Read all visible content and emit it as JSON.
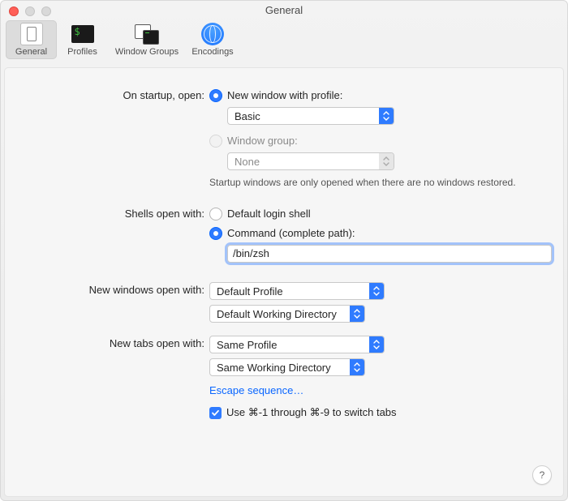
{
  "window_title": "General",
  "toolbar": {
    "items": [
      {
        "label": "General"
      },
      {
        "label": "Profiles"
      },
      {
        "label": "Window Groups"
      },
      {
        "label": "Encodings"
      }
    ]
  },
  "startup": {
    "section_label": "On startup, open:",
    "new_window_label": "New window with profile:",
    "profile_value": "Basic",
    "window_group_label": "Window group:",
    "window_group_value": "None",
    "hint": "Startup windows are only opened when there are no windows restored."
  },
  "shells": {
    "section_label": "Shells open with:",
    "default_label": "Default login shell",
    "command_label": "Command (complete path):",
    "command_value": "/bin/zsh"
  },
  "new_windows": {
    "section_label": "New windows open with:",
    "profile_value": "Default Profile",
    "workdir_value": "Default Working Directory"
  },
  "new_tabs": {
    "section_label": "New tabs open with:",
    "profile_value": "Same Profile",
    "workdir_value": "Same Working Directory"
  },
  "escape_link": "Escape sequence…",
  "switch_tabs_label": "Use ⌘-1 through ⌘-9 to switch tabs",
  "help_label": "?"
}
